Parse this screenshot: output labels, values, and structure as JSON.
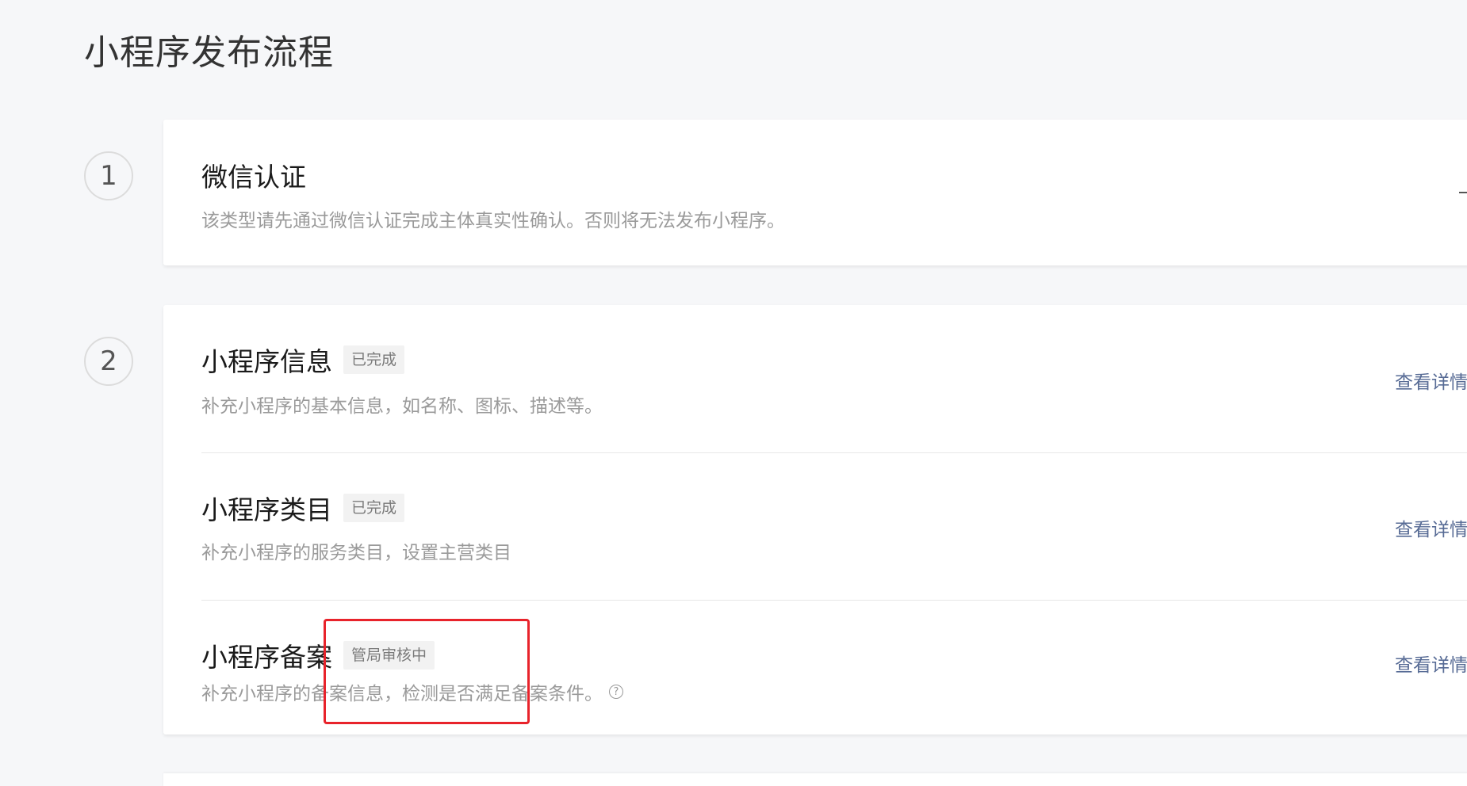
{
  "page": {
    "title": "小程序发布流程"
  },
  "steps": [
    {
      "number": "1",
      "items": [
        {
          "title": "微信认证",
          "badge": "",
          "description": "该类型请先通过微信认证完成主体真实性确认。否则将无法发布小程序。",
          "link": ""
        }
      ]
    },
    {
      "number": "2",
      "items": [
        {
          "title": "小程序信息",
          "badge": "已完成",
          "description": "补充小程序的基本信息，如名称、图标、描述等。",
          "link": "查看详情"
        },
        {
          "title": "小程序类目",
          "badge": "已完成",
          "description": "补充小程序的服务类目，设置主营类目",
          "link": "查看详情"
        },
        {
          "title": "小程序备案",
          "badge": "管局审核中",
          "description": "补充小程序的备案信息，检测是否满足备案条件。",
          "link": "查看详情",
          "help_icon": "question-circle-icon"
        }
      ]
    }
  ],
  "colors": {
    "link": "#576b95",
    "highlight": "#e8232b",
    "badge_bg": "#f2f2f2"
  }
}
